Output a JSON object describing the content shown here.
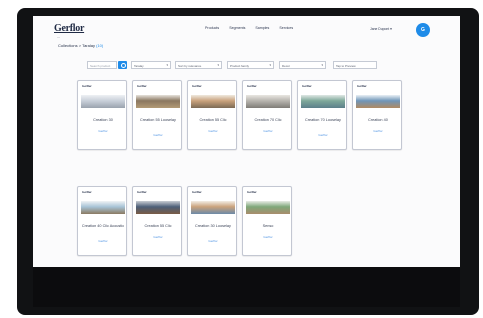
{
  "header": {
    "logo": "Gerflor",
    "logo_sub": "—",
    "nav": [
      "Products",
      "Segments",
      "Samples",
      "Services"
    ],
    "account": "Jane Dupont ▾",
    "avatar_initial": "G"
  },
  "breadcrumb": {
    "root": "Collections",
    "separator": " > ",
    "current": "Taralay",
    "selected": "(10)"
  },
  "filters": {
    "search_placeholder": "Search product",
    "selects": [
      {
        "label": "Taralay",
        "chevron": "▾"
      },
      {
        "label": "Sort by relevance",
        "chevron": "▾"
      },
      {
        "label": "Product family",
        "chevron": "▾"
      },
      {
        "label": "Decor",
        "chevron": "▾"
      }
    ],
    "reset_label": "Tap to Preview"
  },
  "cards": [
    {
      "brand": "Gerflor",
      "title": "Creation 30",
      "price": "Gerflor",
      "photo": [
        "#c8cfd9",
        "#eef1f4",
        "#9aa3ae"
      ]
    },
    {
      "brand": "Gerflor",
      "title": "Creation 55 Looselay",
      "price": "Gerflor",
      "photo": [
        "#8a7760",
        "#e6e2dc",
        "#b39a76"
      ]
    },
    {
      "brand": "Gerflor",
      "title": "Creation 55 Clic",
      "price": "Gerflor",
      "photo": [
        "#c9a27c",
        "#efe9df",
        "#7c6a55"
      ]
    },
    {
      "brand": "Gerflor",
      "title": "Creation 70 Clic",
      "price": "Gerflor",
      "photo": [
        "#b7b4ae",
        "#e9e7e2",
        "#7f7c77"
      ]
    },
    {
      "brand": "Gerflor",
      "title": "Creation 70 Looselay",
      "price": "Gerflor",
      "photo": [
        "#7ea89a",
        "#dfe7e4",
        "#5c7f8a"
      ]
    },
    {
      "brand": "Gerflor",
      "title": "Creation 40",
      "price": "Gerflor",
      "photo": [
        "#6f95b8",
        "#eaf0f5",
        "#b08a62"
      ]
    },
    {
      "brand": "Gerflor",
      "title": "Creation 40 Clic Acoustic",
      "price": "Gerflor",
      "photo": [
        "#a7c3d6",
        "#f0f3f5",
        "#8b7a62"
      ]
    },
    {
      "brand": "Gerflor",
      "title": "Creation 55 Clic",
      "price": "Gerflor",
      "photo": [
        "#4d5f78",
        "#c9cdd4",
        "#7a5c45"
      ]
    },
    {
      "brand": "Gerflor",
      "title": "Creation 30 Looselay",
      "price": "Gerflor",
      "photo": [
        "#c9a27c",
        "#f2ede5",
        "#6d8aa8"
      ]
    },
    {
      "brand": "Gerflor",
      "title": "Senso",
      "price": "Gerflor",
      "photo": [
        "#7fa77a",
        "#e8ece6",
        "#a98d6c"
      ]
    }
  ]
}
